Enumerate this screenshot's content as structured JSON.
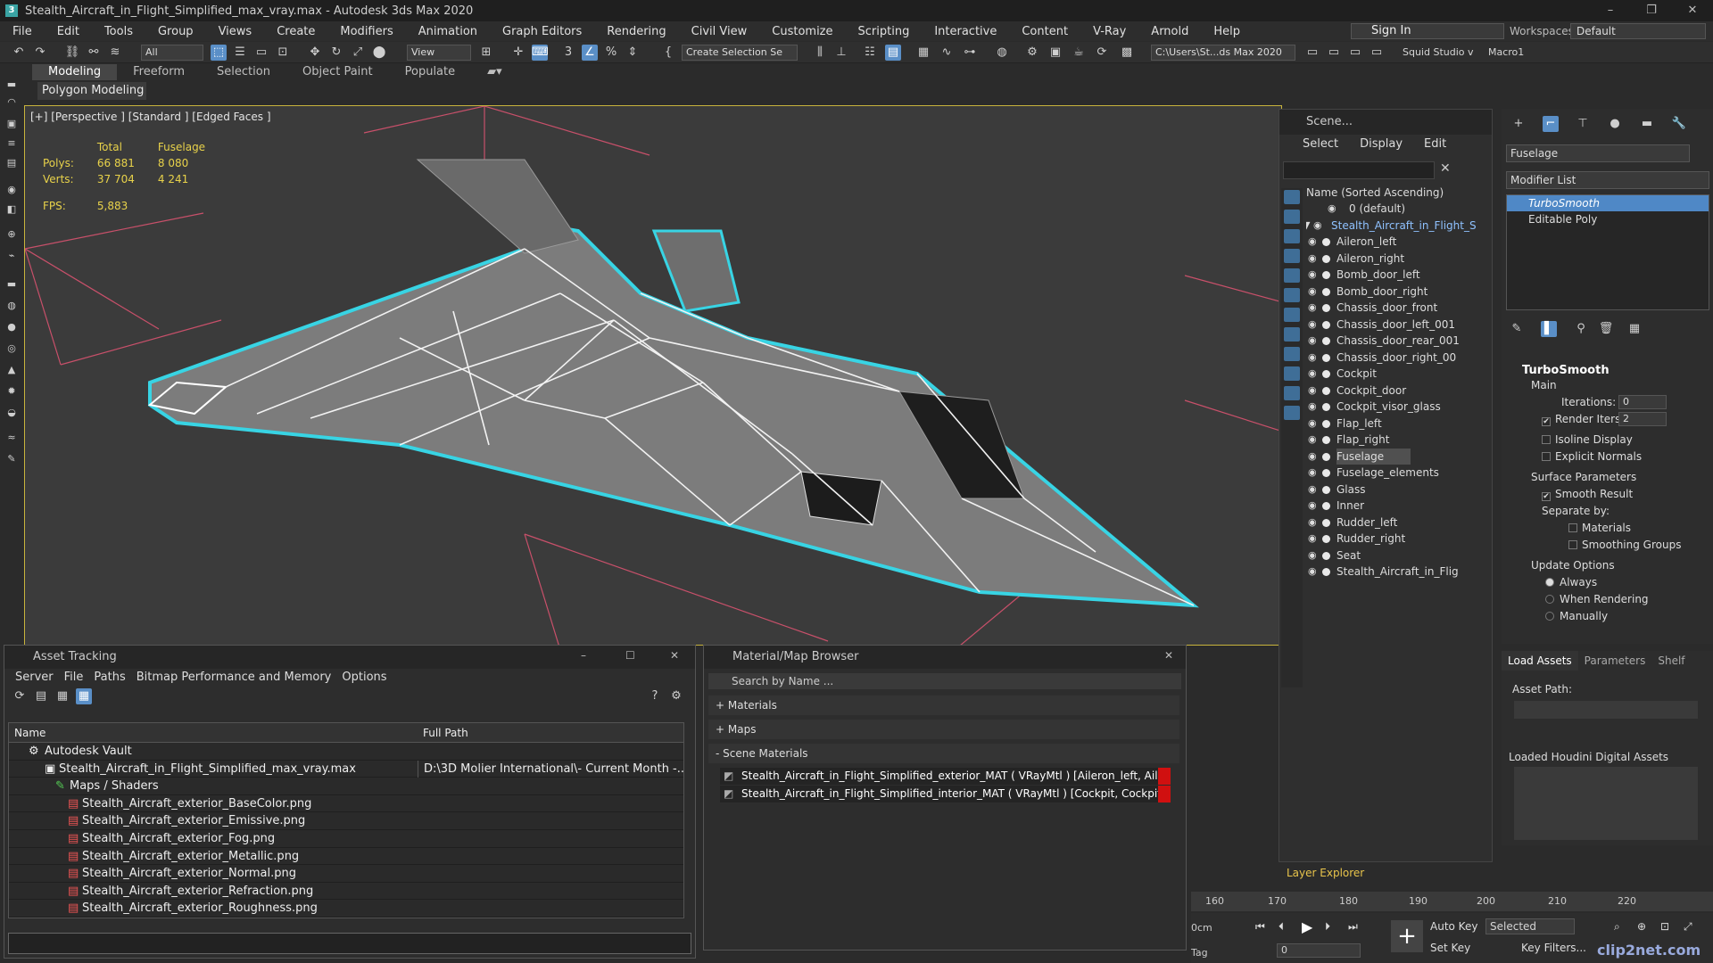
{
  "window": {
    "title": "Stealth_Aircraft_in_Flight_Simplified_max_vray.max - Autodesk 3ds Max 2020",
    "logo": "3"
  },
  "menubar": {
    "items": [
      "File",
      "Edit",
      "Tools",
      "Group",
      "Views",
      "Create",
      "Modifiers",
      "Animation",
      "Graph Editors",
      "Rendering",
      "Civil View",
      "Customize",
      "Scripting",
      "Interactive",
      "Content",
      "V-Ray",
      "Arnold",
      "Help"
    ],
    "sign_in": "Sign In",
    "workspaces_label": "Workspaces:",
    "workspaces_value": "Default"
  },
  "toolbar": {
    "filter": "All",
    "ref_coord": "View",
    "selection_set": "Create Selection Se",
    "project_path": "C:\\Users\\St...ds Max 2020",
    "squid": "Squid Studio v",
    "macro": "Macro1"
  },
  "ribbon": {
    "tabs": [
      "Modeling",
      "Freeform",
      "Selection",
      "Object Paint",
      "Populate"
    ],
    "panel": "Polygon Modeling"
  },
  "viewport": {
    "label": "[+] [Perspective ] [Standard ] [Edged Faces ]",
    "stats": {
      "total_header": "Total",
      "object_header": "Fuselage",
      "polys_label": "Polys:",
      "polys_total": "66 881",
      "polys_obj": "8 080",
      "verts_label": "Verts:",
      "verts_total": "37 704",
      "verts_obj": "4 241",
      "fps_label": "FPS:",
      "fps": "5,883"
    }
  },
  "scene_explorer": {
    "title": "Scene...",
    "menu": [
      "Select",
      "Display",
      "Edit"
    ],
    "column_header": "Name (Sorted Ascending)",
    "layer_default": "0 (default)",
    "root": "Stealth_Aircraft_in_Flight_S",
    "items": [
      "Aileron_left",
      "Aileron_right",
      "Bomb_door_left",
      "Bomb_door_right",
      "Chassis_door_front",
      "Chassis_door_left_001",
      "Chassis_door_rear_001",
      "Chassis_door_right_00",
      "Cockpit",
      "Cockpit_door",
      "Cockpit_visor_glass",
      "Flap_left",
      "Flap_right",
      "Fuselage",
      "Fuselage_elements",
      "Glass",
      "Inner",
      "Rudder_left",
      "Rudder_right",
      "Seat",
      "Stealth_Aircraft_in_Flig"
    ],
    "selected": "Fuselage",
    "layer_explorer": "Layer Explorer"
  },
  "command_panel": {
    "object_name": "Fuselage",
    "modifier_list": "Modifier List",
    "stack": [
      "TurboSmooth",
      "Editable Poly"
    ],
    "rollout_title": "TurboSmooth",
    "main_label": "Main",
    "iterations_label": "Iterations:",
    "iterations_value": "0",
    "render_iters_label": "Render Iters:",
    "render_iters_value": "2",
    "isoline": "Isoline Display",
    "explicit_normals": "Explicit Normals",
    "surface_params": "Surface Parameters",
    "smooth_result": "Smooth Result",
    "separate_by": "Separate by:",
    "materials": "Materials",
    "smoothing_groups": "Smoothing Groups",
    "update_options": "Update Options",
    "always": "Always",
    "when_rendering": "When Rendering",
    "manually": "Manually"
  },
  "houdini_panel": {
    "tabs": [
      "Load Assets",
      "Parameters",
      "Shelf"
    ],
    "asset_path_label": "Asset Path:",
    "loaded_label": "Loaded Houdini Digital Assets"
  },
  "asset_tracking": {
    "title": "Asset Tracking",
    "menu": [
      "Server",
      "File",
      "Paths",
      "Bitmap Performance and Memory",
      "Options"
    ],
    "col_name": "Name",
    "col_path": "Full Path",
    "rows": [
      {
        "name": "Autodesk Vault",
        "path": "",
        "indent": 1
      },
      {
        "name": "Stealth_Aircraft_in_Flight_Simplified_max_vray.max",
        "path": "D:\\3D Molier International\\- Current Month -...",
        "indent": 2
      },
      {
        "name": "Maps / Shaders",
        "path": "",
        "indent": 3
      },
      {
        "name": "Stealth_Aircraft_exterior_BaseColor.png",
        "path": "",
        "indent": 4
      },
      {
        "name": "Stealth_Aircraft_exterior_Emissive.png",
        "path": "",
        "indent": 4
      },
      {
        "name": "Stealth_Aircraft_exterior_Fog.png",
        "path": "",
        "indent": 4
      },
      {
        "name": "Stealth_Aircraft_exterior_Metallic.png",
        "path": "",
        "indent": 4
      },
      {
        "name": "Stealth_Aircraft_exterior_Normal.png",
        "path": "",
        "indent": 4
      },
      {
        "name": "Stealth_Aircraft_exterior_Refraction.png",
        "path": "",
        "indent": 4
      },
      {
        "name": "Stealth_Aircraft_exterior_Roughness.png",
        "path": "",
        "indent": 4
      }
    ]
  },
  "material_browser": {
    "title": "Material/Map Browser",
    "search_placeholder": "Search by Name ...",
    "sections": [
      "+ Materials",
      "+ Maps",
      "- Scene Materials"
    ],
    "materials": [
      "Stealth_Aircraft_in_Flight_Simplified_exterior_MAT ( VRayMtl ) [Aileron_left, Ail...",
      "Stealth_Aircraft_in_Flight_Simplified_interior_MAT ( VRayMtl ) [Cockpit, Cockpit..."
    ]
  },
  "timeline": {
    "ticks": [
      "160",
      "170",
      "180",
      "190",
      "200",
      "210",
      "220"
    ],
    "frame": "0",
    "auto_key": "Auto Key",
    "set_key": "Set Key",
    "key_mode": "Selected",
    "key_filters": "Key Filters...",
    "cm_label": "0cm",
    "tag_label": "Tag"
  },
  "watermark": "clip2net.com",
  "colors": {
    "accent": "#4f88c6",
    "wire_select": "#38d4e4",
    "viewport_border": "#c8b43c",
    "stats": "#e8d24a"
  }
}
